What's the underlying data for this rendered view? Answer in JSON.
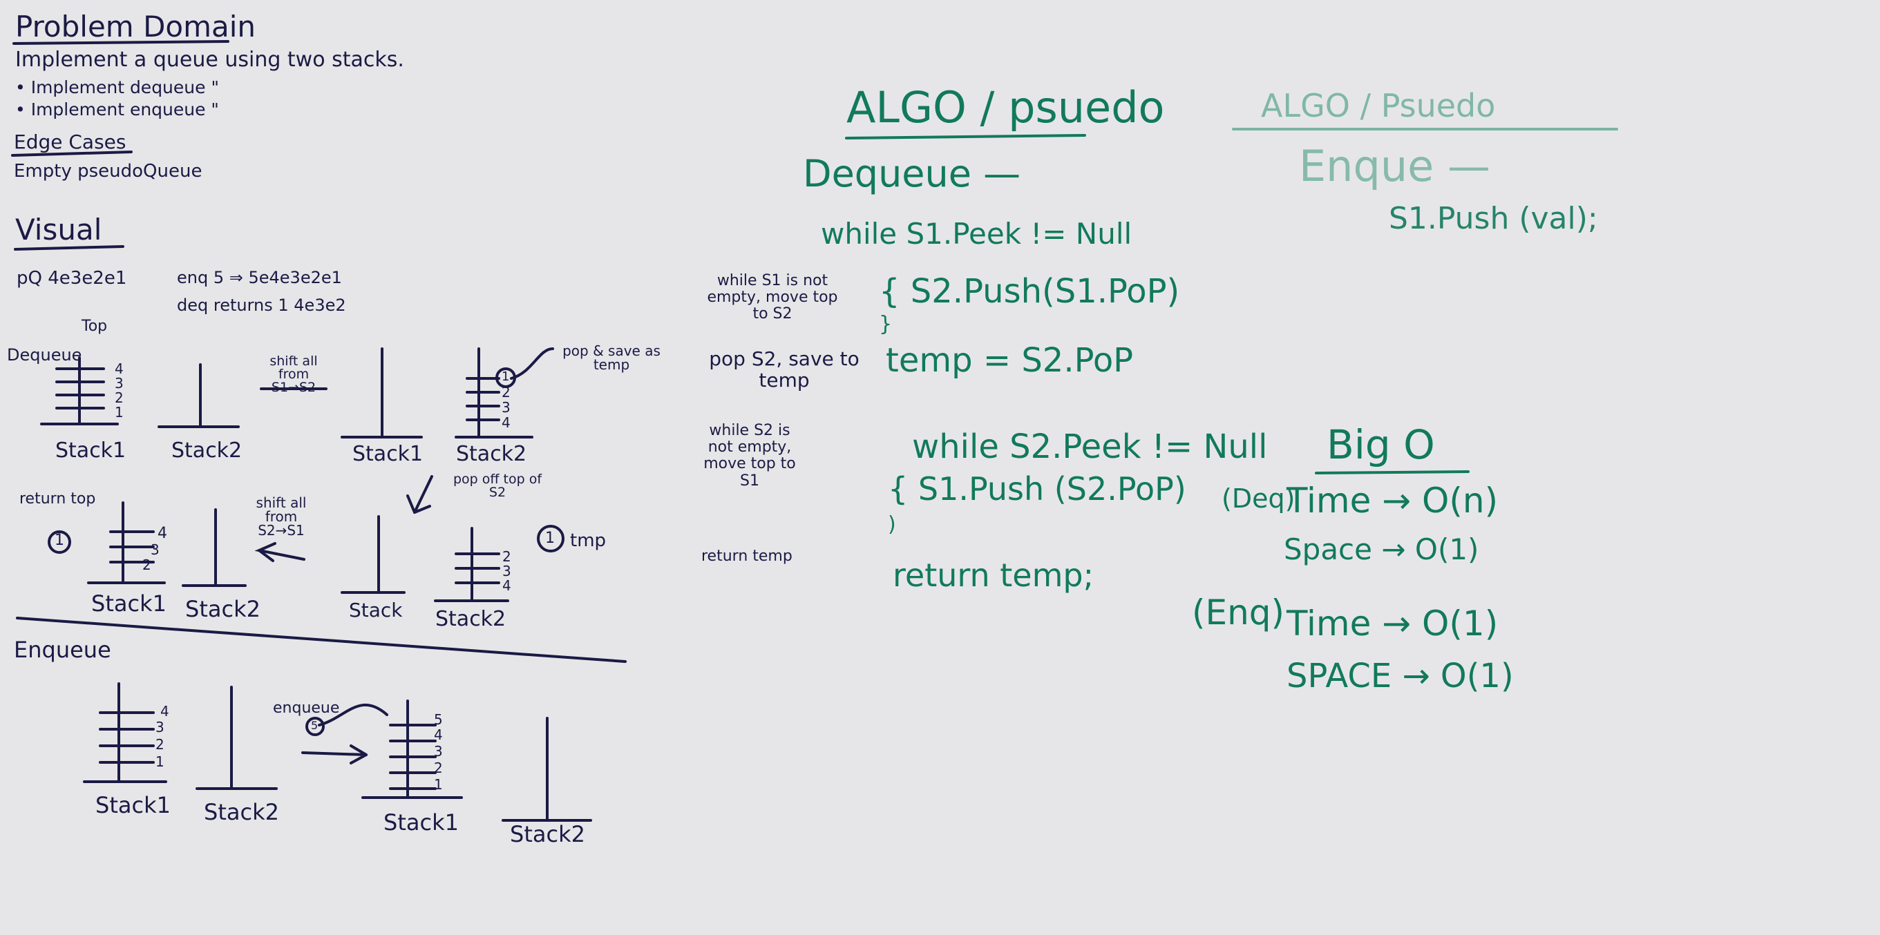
{
  "colors": {
    "board": "#e6e6e8",
    "ink_navy": "#1b1a45",
    "ink_green": "#117a5a",
    "ink_faded": "#5fa88f"
  },
  "left": {
    "problem_domain": "Problem Domain",
    "goal": "Implement a queue using two stacks.",
    "item_dequeue": "• Implement dequeue \"",
    "item_enqueue": "• Implement enqueue \"",
    "edge_cases": "Edge Cases",
    "edge_case_1": "Empty pseudoQueue",
    "visual": "Visual",
    "pq": "pQ  4e3e2e1",
    "enq": "enq 5 ⇒ 5e4e3e2e1",
    "deq": "deq returns 1  4e3e2",
    "top": "Top",
    "dequeue_label": "Dequeue",
    "shift_1": "shift all from S1→S2",
    "pop_save": "pop & save as temp",
    "pop_off": "pop off top of S2",
    "return_top": "return top",
    "shift_2": "shift all from S2→S1",
    "tmp": "tmp",
    "enqueue_label": "Enqueue",
    "enqueue_arrow": "enqueue",
    "stack1": "Stack1",
    "stack2": "Stack2",
    "stack1b": "Stack1",
    "stack2b": "Stack2",
    "stack1c": "Stack1",
    "stack2c": "Stack2",
    "stack1d": "Stack",
    "stack2d": "Stack2",
    "stack1e": "Stack1",
    "stack2e": "Stack2",
    "stack1f": "Stack1",
    "stack2f": "Stack2",
    "n1": "1",
    "n2": "2",
    "n3": "3",
    "n4": "4",
    "n5": "5"
  },
  "middle": {
    "note_1": "while S1 is not empty, move top to S2",
    "note_2": "pop S2, save to temp",
    "note_3": "while S2 is not empty, move top to S1",
    "note_4": "return temp"
  },
  "algo": {
    "title": "ALGO / psuedo",
    "dequeue": "Dequeue —",
    "line1": "while S1.Peek != Null",
    "line2": "{  S2.Push(S1.PoP)",
    "line3": "}",
    "line4": "temp = S2.PoP",
    "line5": "while S2.Peek != Null",
    "line6": "{  S1.Push (S2.PoP)",
    "line7": ")",
    "line8": "return temp;"
  },
  "algo2": {
    "title": "ALGO / Psuedo",
    "enqueue": "Enque —",
    "line1": "S1.Push (val);"
  },
  "bigo": {
    "title": "Big O",
    "deq_tag": "(Deq)",
    "deq_time": "Time → O(n)",
    "deq_space": "Space → O(1)",
    "enq_tag": "(Enq)",
    "enq_time": "Time → O(1)",
    "enq_space": "SPACE → O(1)"
  }
}
